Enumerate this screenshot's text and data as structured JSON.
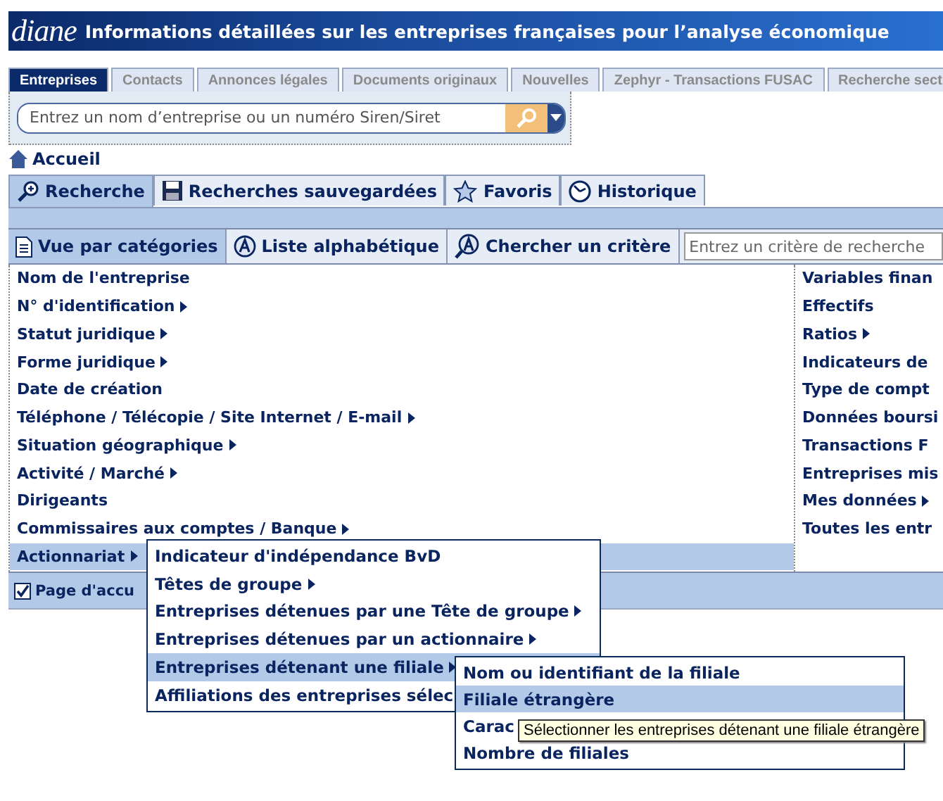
{
  "header": {
    "logo": "diane",
    "title": "Informations détaillées sur les entreprises françaises pour l’analyse économique"
  },
  "top_tabs": [
    {
      "label": "Entreprises",
      "selected": true
    },
    {
      "label": "Contacts",
      "selected": false
    },
    {
      "label": "Annonces légales",
      "selected": false
    },
    {
      "label": "Documents originaux",
      "selected": false
    },
    {
      "label": "Nouvelles",
      "selected": false
    },
    {
      "label": "Zephyr - Transactions FUSAC",
      "selected": false
    },
    {
      "label": "Recherche sect",
      "selected": false
    }
  ],
  "search": {
    "placeholder": "Entrez un nom d’entreprise ou un numéro Siren/Siret"
  },
  "breadcrumb": "Accueil",
  "main_tabs": [
    {
      "label": "Recherche",
      "selected": true
    },
    {
      "label": "Recherches sauvegardées",
      "selected": false
    },
    {
      "label": "Favoris",
      "selected": false
    },
    {
      "label": "Historique",
      "selected": false
    }
  ],
  "view_tabs": [
    {
      "label": "Vue par catégories",
      "selected": true
    },
    {
      "label": "Liste alphabétique",
      "selected": false
    },
    {
      "label": "Chercher un critère",
      "selected": false
    }
  ],
  "criteria_search": {
    "placeholder": "Entrez un critère de recherche"
  },
  "categories_left": [
    {
      "label": "Nom de l'entreprise",
      "has_submenu": false,
      "selected": false
    },
    {
      "label": "N° d'identification",
      "has_submenu": true,
      "selected": false
    },
    {
      "label": "Statut juridique",
      "has_submenu": true,
      "selected": false
    },
    {
      "label": "Forme juridique",
      "has_submenu": true,
      "selected": false
    },
    {
      "label": "Date de création",
      "has_submenu": false,
      "selected": false
    },
    {
      "label": "Téléphone / Télécopie / Site Internet / E-mail",
      "has_submenu": true,
      "selected": false
    },
    {
      "label": "Situation géographique",
      "has_submenu": true,
      "selected": false
    },
    {
      "label": "Activité / Marché",
      "has_submenu": true,
      "selected": false
    },
    {
      "label": "Dirigeants",
      "has_submenu": false,
      "selected": false
    },
    {
      "label": "Commissaires aux comptes / Banque",
      "has_submenu": true,
      "selected": false
    },
    {
      "label": "Actionnariat",
      "has_submenu": true,
      "selected": true
    }
  ],
  "categories_right": [
    {
      "label": "Variables finan",
      "has_submenu": false,
      "selected": false
    },
    {
      "label": "Effectifs",
      "has_submenu": false,
      "selected": false
    },
    {
      "label": "Ratios",
      "has_submenu": true,
      "selected": false
    },
    {
      "label": "Indicateurs de",
      "has_submenu": false,
      "selected": false
    },
    {
      "label": "Type de compt",
      "has_submenu": false,
      "selected": false
    },
    {
      "label": "Données boursi",
      "has_submenu": false,
      "selected": false
    },
    {
      "label": "Transactions F",
      "has_submenu": false,
      "selected": false
    },
    {
      "label": "Entreprises mis",
      "has_submenu": false,
      "selected": false
    },
    {
      "label": "Mes données",
      "has_submenu": true,
      "selected": false
    },
    {
      "label": "Toutes les entr",
      "has_submenu": false,
      "selected": false
    }
  ],
  "home_page": {
    "label": "Page d'accu",
    "checked": true
  },
  "menu": [
    {
      "label": "Indicateur d'indépendance BvD",
      "has_submenu": false,
      "selected": false
    },
    {
      "label": "Têtes de groupe",
      "has_submenu": true,
      "selected": false
    },
    {
      "label": "Entreprises détenues par une Tête de groupe",
      "has_submenu": true,
      "selected": false
    },
    {
      "label": "Entreprises détenues par un actionnaire",
      "has_submenu": true,
      "selected": false
    },
    {
      "label": "Entreprises détenant une filiale",
      "has_submenu": true,
      "selected": true
    },
    {
      "label": "Affiliations des entreprises sélec",
      "has_submenu": false,
      "selected": false
    }
  ],
  "submenu": [
    {
      "label": "Nom ou identifiant de la filiale",
      "has_submenu": false,
      "selected": false
    },
    {
      "label": "Filiale étrangère",
      "has_submenu": false,
      "selected": true
    },
    {
      "label": "Carac",
      "has_submenu": false,
      "selected": false
    },
    {
      "label": "Nombre de filiales",
      "has_submenu": false,
      "selected": false
    }
  ],
  "tooltip": "Sélectionner les entreprises détenant une filiale étrangère"
}
